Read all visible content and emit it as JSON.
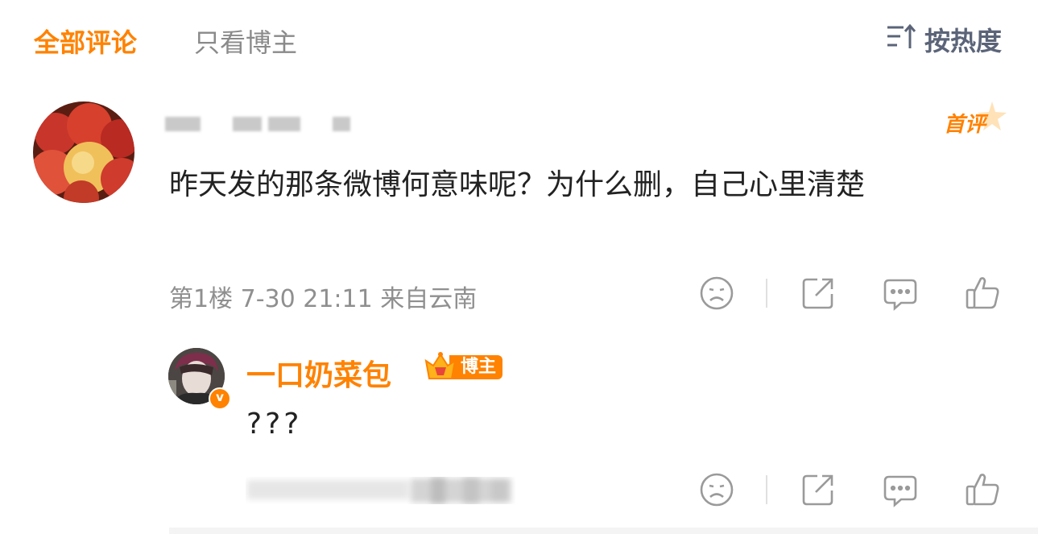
{
  "tabs": {
    "all": "全部评论",
    "blogger_only": "只看博主"
  },
  "sort": {
    "label": "按热度",
    "icon": "sort-icon"
  },
  "comment": {
    "first_badge": "首评",
    "text": "昨天发的那条微博何意味呢？为什么删，自己心里清楚",
    "meta": "第1楼 7-30 21:11 来自云南"
  },
  "reply": {
    "username": "一口奶菜包",
    "badge": "博主",
    "verified_mark": "v",
    "text": "???"
  },
  "colors": {
    "accent": "#ff8200",
    "muted": "#8f8f8f",
    "icon": "#9a9a9a",
    "sort": "#5b6478"
  },
  "icons": [
    "sad-face-icon",
    "share-icon",
    "comment-icon",
    "like-icon"
  ]
}
